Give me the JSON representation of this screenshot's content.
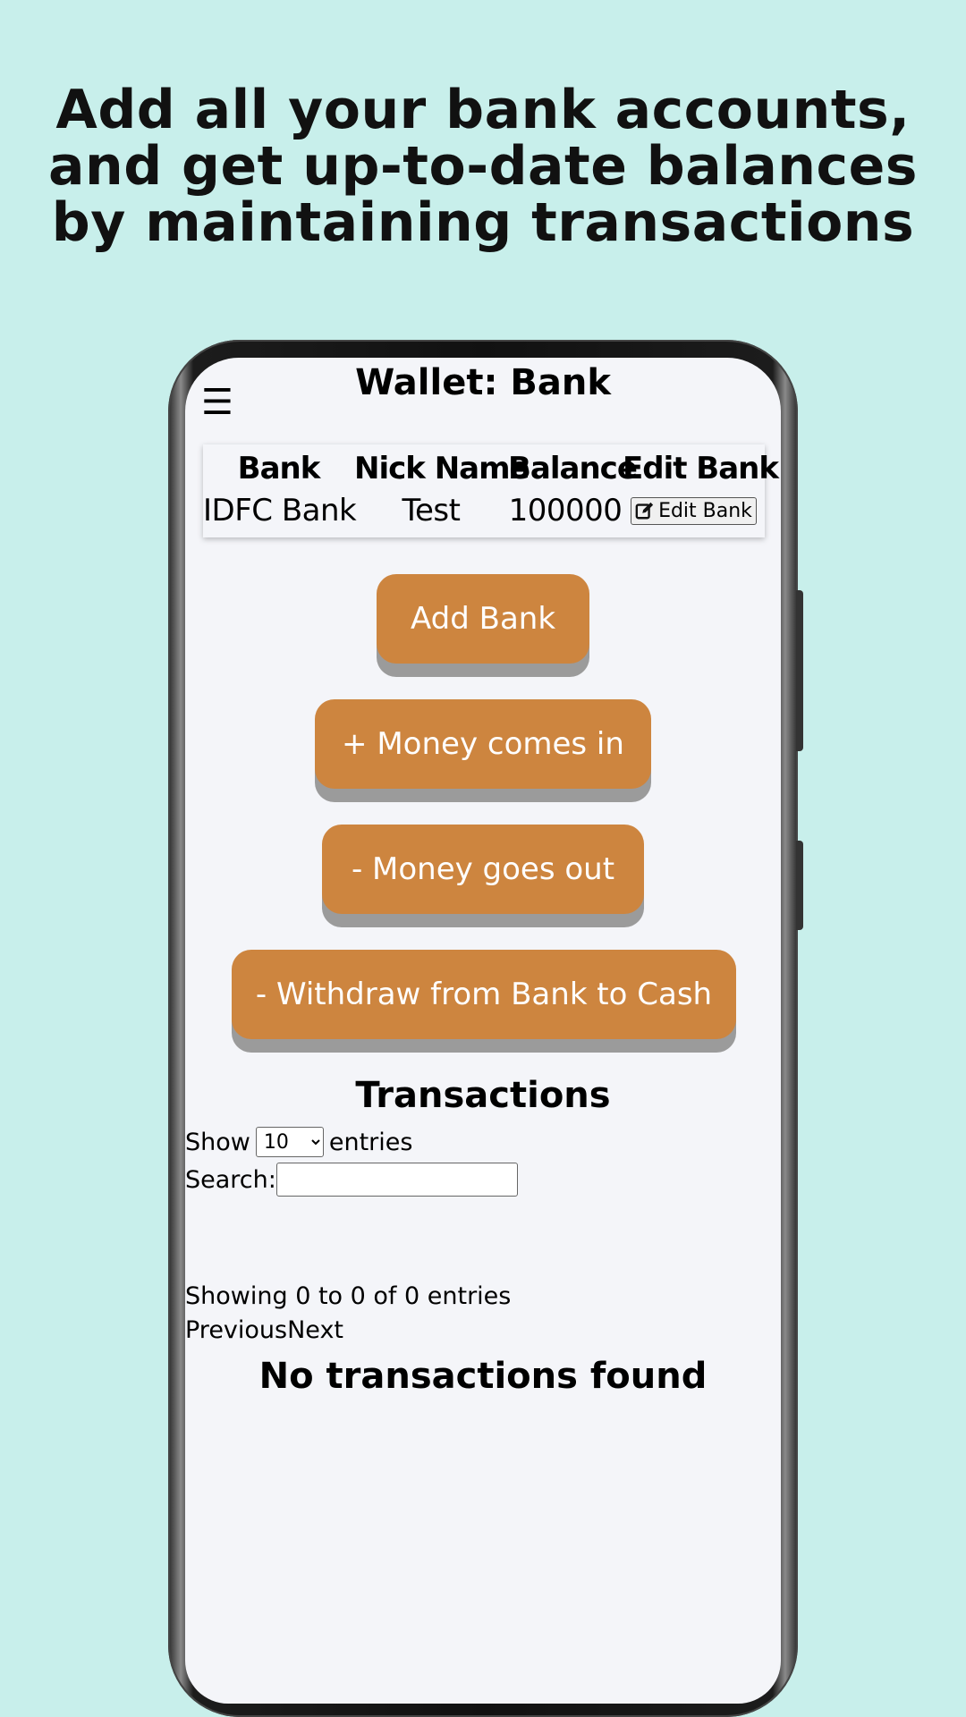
{
  "headline": "Add all your bank accounts, and get up-to-date balances by maintaining transactions",
  "app": {
    "title": "Wallet: Bank",
    "menu_icon": "☰"
  },
  "bank_table": {
    "headers": [
      "Bank",
      "Nick Name",
      "Balance",
      "Edit Bank"
    ],
    "rows": [
      {
        "bank": "IDFC Bank",
        "nick_name": "Test",
        "balance": "100000",
        "edit_label": "Edit Bank"
      }
    ]
  },
  "actions": {
    "add_bank": "Add Bank",
    "money_in": "+ Money comes in",
    "money_out": "- Money goes out",
    "withdraw": "- Withdraw from Bank to Cash"
  },
  "transactions": {
    "title": "Transactions",
    "show_label": "Show",
    "entries_value": "10",
    "entries_label": "entries",
    "search_label": "Search:",
    "search_value": "",
    "info": "Showing 0 to 0 of 0 entries",
    "previous": "Previous",
    "next": "Next",
    "empty_message": "No transactions found"
  },
  "colors": {
    "background": "#c8efeb",
    "button": "#cd853f",
    "button_shadow": "#9b9b9b",
    "screen": "#f4f5f9"
  }
}
